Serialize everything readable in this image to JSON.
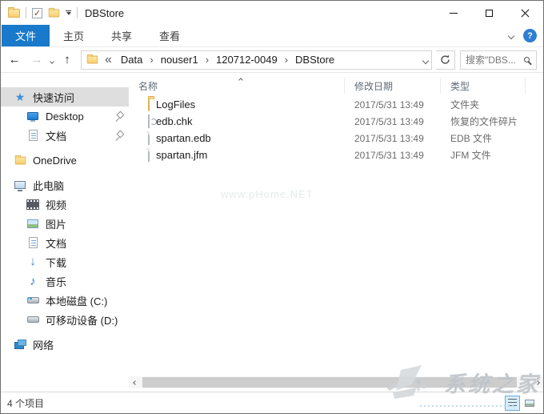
{
  "window": {
    "title": "DBStore",
    "qat_icons": [
      "folder-icon",
      "properties-check-icon",
      "new-folder-icon",
      "customize-dropdown-icon"
    ],
    "buttons": [
      "minimize",
      "maximize",
      "close"
    ]
  },
  "ribbon": {
    "tabs": [
      {
        "id": "file",
        "label": "文件",
        "active": true
      },
      {
        "id": "home",
        "label": "主页",
        "active": false
      },
      {
        "id": "share",
        "label": "共享",
        "active": false
      },
      {
        "id": "view",
        "label": "查看",
        "active": false
      }
    ],
    "collapse_icon": "chevron-down-icon",
    "help_label": "?"
  },
  "address": {
    "nav_icons": {
      "back": "←",
      "forward": "→",
      "dropdown": "chevron-down",
      "up": "↑"
    },
    "prefix": "«",
    "crumbs": [
      "Data",
      "nouser1",
      "120712-0049",
      "DBStore"
    ],
    "refresh_icon": "refresh-icon"
  },
  "search": {
    "text": "搜索\"DBS..."
  },
  "sidebar": {
    "items": [
      {
        "id": "quick-access",
        "label": "快速访问",
        "icon": "star",
        "level": 0,
        "selected": true,
        "pinned": false,
        "gap": false
      },
      {
        "id": "desktop",
        "label": "Desktop",
        "icon": "desktop",
        "level": 1,
        "selected": false,
        "pinned": true,
        "gap": false
      },
      {
        "id": "documents-qa",
        "label": "文档",
        "icon": "doc",
        "level": 1,
        "selected": false,
        "pinned": true,
        "gap": false
      },
      {
        "id": "onedrive",
        "label": "OneDrive",
        "icon": "folder",
        "level": 0,
        "selected": false,
        "pinned": false,
        "gap": true
      },
      {
        "id": "this-pc",
        "label": "此电脑",
        "icon": "computer",
        "level": 0,
        "selected": false,
        "pinned": false,
        "gap": true
      },
      {
        "id": "videos",
        "label": "视频",
        "icon": "video",
        "level": 1,
        "selected": false,
        "pinned": false,
        "gap": false
      },
      {
        "id": "pictures",
        "label": "图片",
        "icon": "picture",
        "level": 1,
        "selected": false,
        "pinned": false,
        "gap": false
      },
      {
        "id": "documents",
        "label": "文档",
        "icon": "doc",
        "level": 1,
        "selected": false,
        "pinned": false,
        "gap": false
      },
      {
        "id": "downloads",
        "label": "下载",
        "icon": "download",
        "level": 1,
        "selected": false,
        "pinned": false,
        "gap": false
      },
      {
        "id": "music",
        "label": "音乐",
        "icon": "music",
        "level": 1,
        "selected": false,
        "pinned": false,
        "gap": false
      },
      {
        "id": "disk-c",
        "label": "本地磁盘 (C:)",
        "icon": "disk-win",
        "level": 1,
        "selected": false,
        "pinned": false,
        "gap": false
      },
      {
        "id": "disk-d",
        "label": "可移动设备 (D:)",
        "icon": "disk",
        "level": 1,
        "selected": false,
        "pinned": false,
        "gap": false
      },
      {
        "id": "network",
        "label": "网络",
        "icon": "network",
        "level": 0,
        "selected": false,
        "pinned": false,
        "gap": true
      }
    ]
  },
  "file_list": {
    "columns": [
      "名称",
      "修改日期",
      "类型"
    ],
    "sort_indicator": "^",
    "rows": [
      {
        "name": "LogFiles",
        "icon": "folder",
        "date": "2017/5/31 13:49",
        "type": "文件夹"
      },
      {
        "name": "edb.chk",
        "icon": "chk",
        "date": "2017/5/31 13:49",
        "type": "恢复的文件碎片"
      },
      {
        "name": "spartan.edb",
        "icon": "file",
        "date": "2017/5/31 13:49",
        "type": "EDB 文件"
      },
      {
        "name": "spartan.jfm",
        "icon": "file",
        "date": "2017/5/31 13:49",
        "type": "JFM 文件"
      }
    ]
  },
  "status_bar": {
    "items_count": "4 个项目"
  },
  "watermarks": {
    "center": "www.pHome.NET",
    "site": "系统之家"
  },
  "colors": {
    "accent_tab": "#1979ca",
    "help_circle": "#2d7dd2",
    "sidebar_selected": "#dedede",
    "folder": "#f8cf6f"
  }
}
